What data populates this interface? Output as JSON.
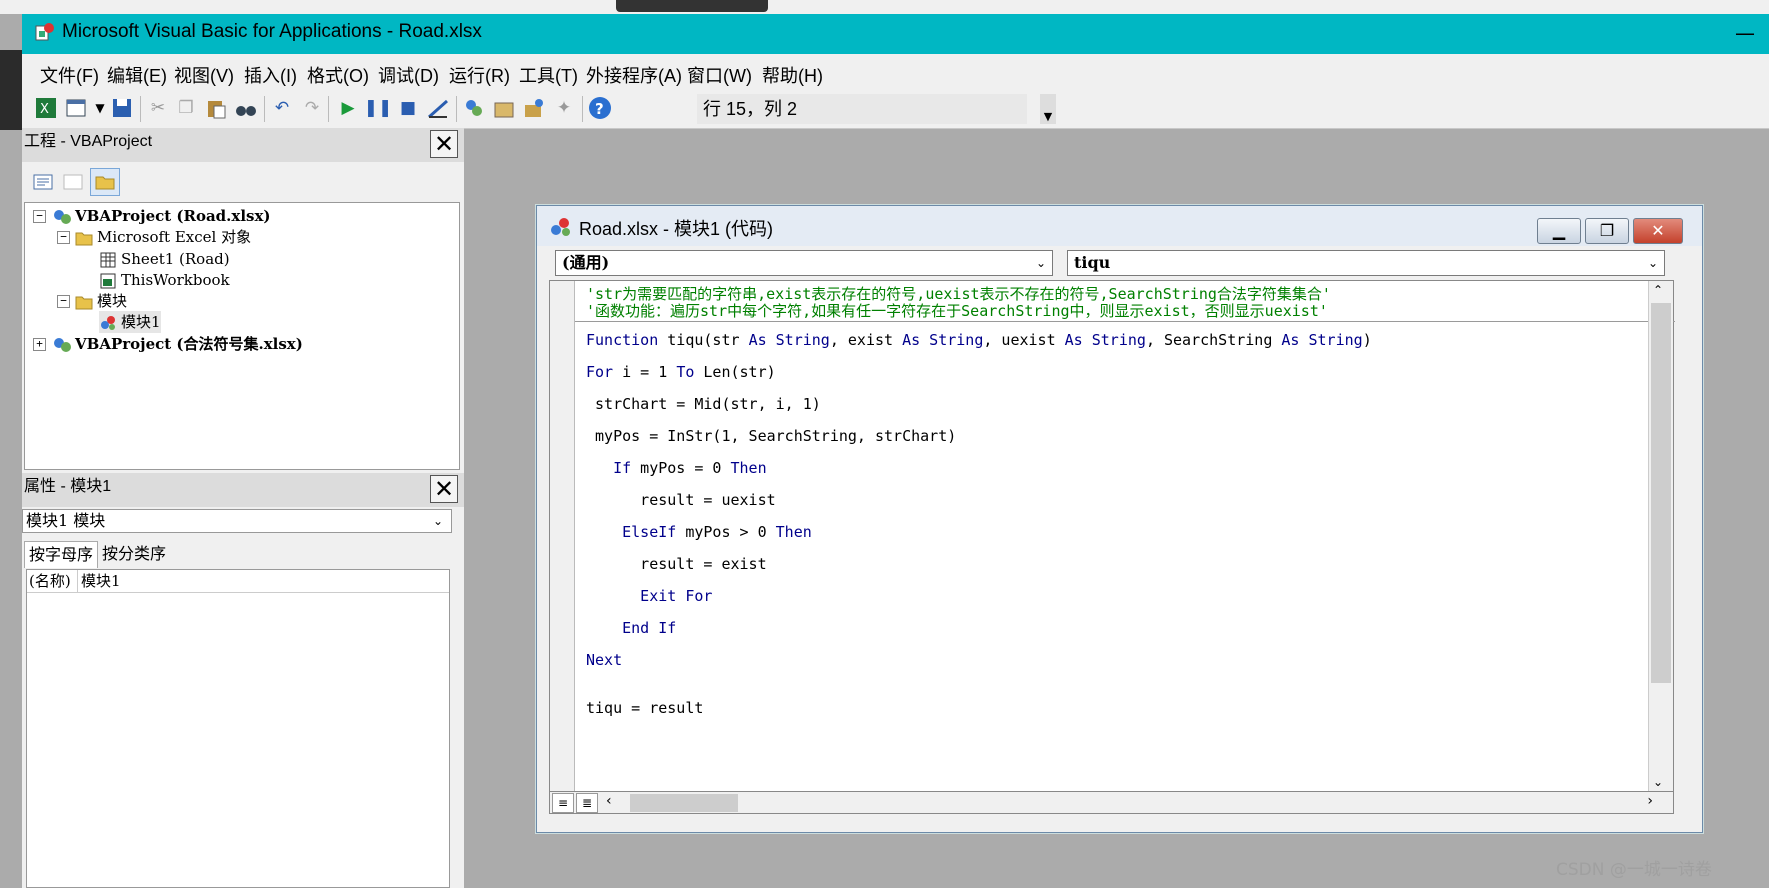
{
  "window": {
    "title": "Microsoft Visual Basic for Applications - Road.xlsx",
    "minimize": "—"
  },
  "menu": [
    "文件(F)",
    "编辑(E)",
    "视图(V)",
    "插入(I)",
    "格式(O)",
    "调试(D)",
    "运行(R)",
    "工具(T)",
    "外接程序(A)",
    "窗口(W)",
    "帮助(H)"
  ],
  "toolbar": {
    "position": "行 15，列 2"
  },
  "project": {
    "title": "工程 - VBAProject",
    "close": "✕",
    "tree": [
      {
        "label": "VBAProject (Road.xlsx)",
        "bold": true
      },
      {
        "label": "Microsoft Excel 对象"
      },
      {
        "label": "Sheet1 (Road)"
      },
      {
        "label": "ThisWorkbook"
      },
      {
        "label": "模块"
      },
      {
        "label": "模块1"
      },
      {
        "label": "VBAProject (合法符号集.xlsx)",
        "bold": true
      }
    ]
  },
  "properties": {
    "title": "属性 - 模块1",
    "close": "✕",
    "object": "模块1 模块",
    "tabs": [
      "按字母序",
      "按分类序"
    ],
    "row": {
      "name": "(名称)",
      "value": "模块1"
    }
  },
  "code_window": {
    "title": "Road.xlsx - 模块1 (代码)",
    "object_combo": "(通用)",
    "proc_combo": "tiqu",
    "comments": [
      "'str为需要匹配的字符串,exist表示存在的符号,uexist表示不存在的符号,SearchString合法字符集集合'",
      "'函数功能：遍历str中每个字符,如果有任一字符存在于SearchString中，则显示exist，否则显示uexist'"
    ],
    "lines": [
      {
        "kw1": "Function",
        "text": " tiqu(str ",
        "kw2": "As String",
        "rest": ", exist ",
        "kw3": "As String",
        "rest2": ", uexist ",
        "kw4": "As String",
        "rest3": ", SearchString ",
        "kw5": "As String",
        "rest4": ")"
      },
      {
        "kw1": "For",
        "text": " i = 1 ",
        "kw2": "To",
        "rest": " Len(str)"
      },
      {
        "text": " strChart = Mid(str, i, 1)"
      },
      {
        "text": " myPos = InStr(1, SearchString, strChart)"
      },
      {
        "kw1": "   If",
        "text": " myPos = 0 ",
        "kw2": "Then"
      },
      {
        "text": "      result = uexist"
      },
      {
        "kw1": "    ElseIf",
        "text": " myPos > 0 ",
        "kw2": "Then"
      },
      {
        "text": "      result = exist"
      },
      {
        "kw1": "      Exit For"
      },
      {
        "kw1": "    End If"
      },
      {
        "kw1": "Next"
      },
      {
        "text": "tiqu = result"
      }
    ]
  },
  "watermark": "CSDN @一城一诗卷",
  "colors": {
    "titlebar": "#00b7c3",
    "keyword": "#00008b",
    "comment": "#008000"
  }
}
